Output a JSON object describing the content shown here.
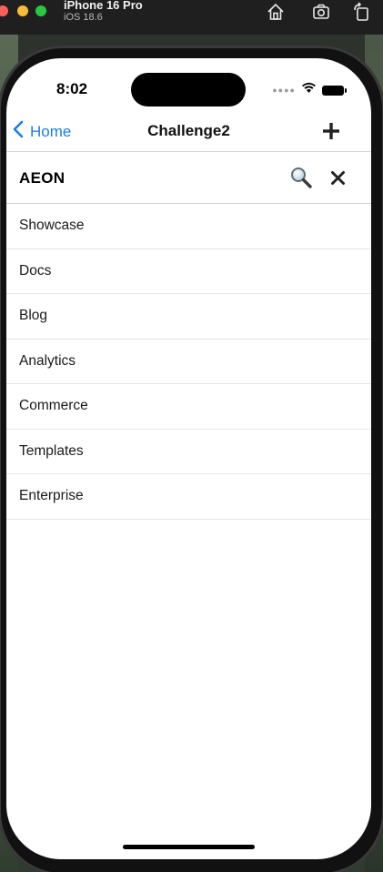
{
  "simulator": {
    "device_name": "iPhone 16 Pro",
    "os_version": "iOS 18.6"
  },
  "status_bar": {
    "time": "8:02"
  },
  "nav": {
    "back_label": "Home",
    "title": "Challenge2"
  },
  "header": {
    "brand": "AEON"
  },
  "menu": {
    "items": [
      {
        "label": "Showcase"
      },
      {
        "label": "Docs"
      },
      {
        "label": "Blog"
      },
      {
        "label": "Analytics"
      },
      {
        "label": "Commerce"
      },
      {
        "label": "Templates"
      },
      {
        "label": "Enterprise"
      }
    ]
  },
  "colors": {
    "accent": "#1a7ee6",
    "text": "#1a1a1a",
    "divider": "#e6e6e6"
  },
  "icons": [
    "home-icon",
    "screenshot-icon",
    "rotate-icon",
    "wifi-icon",
    "battery-icon",
    "chevron-left-icon",
    "plus-icon",
    "search-icon",
    "close-icon"
  ]
}
